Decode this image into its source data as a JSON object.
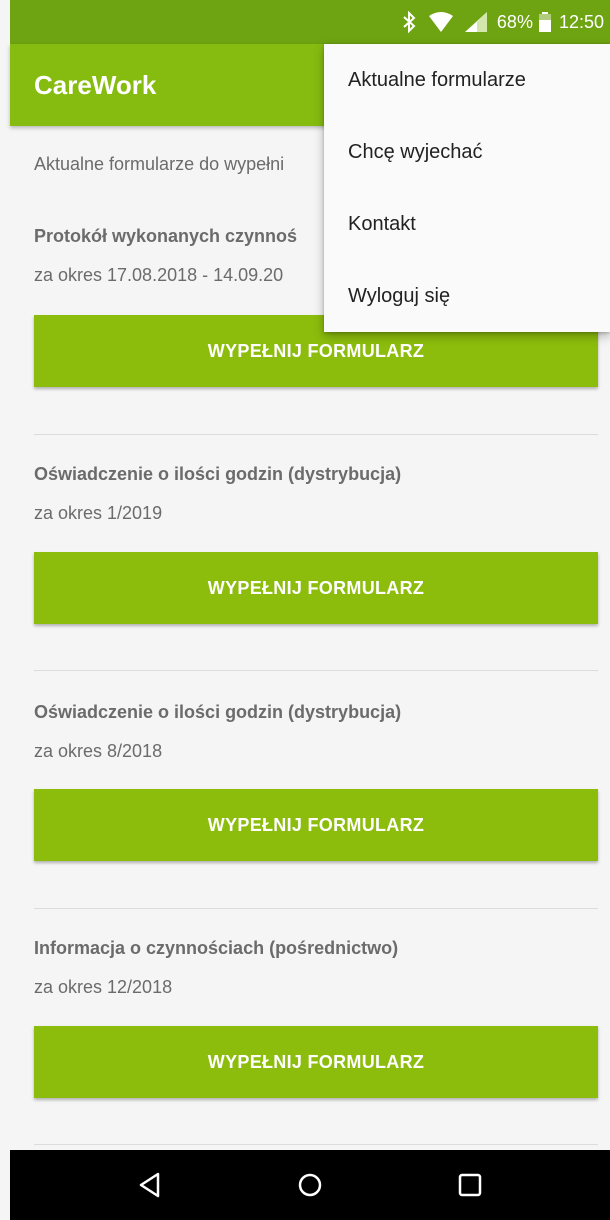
{
  "status_bar": {
    "battery_percent": "68%",
    "time": "12:50",
    "icons": [
      "bluetooth-icon",
      "wifi-icon",
      "signal-icon",
      "battery-icon"
    ]
  },
  "app_bar": {
    "title": "CareWork"
  },
  "content": {
    "intro": "Aktualne formularze do wypełni",
    "forms": [
      {
        "title": "Protokół wykonanych czynnoś",
        "period": "za okres 17.08.2018 - 14.09.20",
        "button": "WYPEŁNIJ FORMULARZ"
      },
      {
        "title": "Oświadczenie o ilości godzin (dystrybucja)",
        "period": "za okres 1/2019",
        "button": "WYPEŁNIJ FORMULARZ"
      },
      {
        "title": "Oświadczenie o ilości godzin (dystrybucja)",
        "period": "za okres 8/2018",
        "button": "WYPEŁNIJ FORMULARZ"
      },
      {
        "title": "Informacja o czynnościach (pośrednictwo)",
        "period": "za okres 12/2018",
        "button": "WYPEŁNIJ FORMULARZ"
      }
    ]
  },
  "menu": {
    "items": [
      "Aktualne formularze",
      "Chcę wyjechać",
      "Kontakt",
      "Wyloguj się"
    ]
  },
  "nav_bar": {
    "icons": [
      "back-icon",
      "home-icon",
      "recents-icon"
    ]
  },
  "colors": {
    "status_bar": "#6ea412",
    "app_bar": "#86bc10",
    "button": "#8cbd0c",
    "text_secondary": "#6b6b6b"
  }
}
